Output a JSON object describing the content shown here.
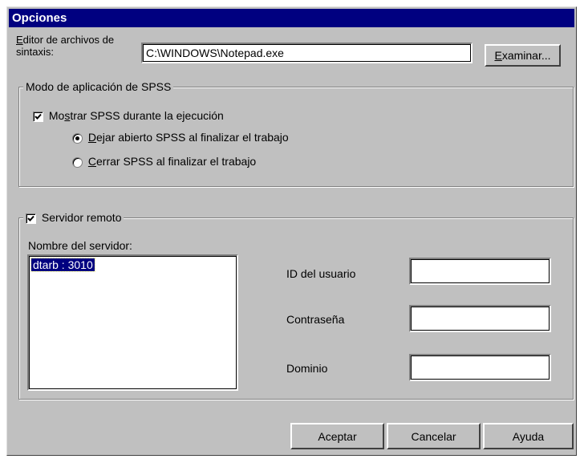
{
  "dialog": {
    "title": "Opciones"
  },
  "syntax_editor": {
    "label_line1_access": "E",
    "label_line1_rest": "ditor de archivos de",
    "label_line2": "sintaxis:",
    "value": "C:\\WINDOWS\\Notepad.exe",
    "browse_access": "E",
    "browse_rest": "xaminar..."
  },
  "spss_mode": {
    "legend": "Modo de aplicación de SPSS",
    "show_checkbox": {
      "label_pre": "Mo",
      "label_access": "s",
      "label_post": "trar SPSS durante la ejecución",
      "checked": true
    },
    "options": [
      {
        "access": "D",
        "rest": "ejar abierto SPSS al finalizar el trabajo",
        "selected": true
      },
      {
        "access": "C",
        "rest": "errar SPSS al finalizar el trabajo",
        "selected": false
      }
    ]
  },
  "remote_server": {
    "legend": "Servidor remoto",
    "checked": true,
    "server_name_label": "Nombre del servidor:",
    "servers": [
      "dtarb : 3010"
    ],
    "user_id_label": "ID del usuario",
    "user_id_value": "",
    "password_label": "Contraseña",
    "password_value": "",
    "domain_label": "Dominio",
    "domain_value": ""
  },
  "buttons": {
    "ok": "Aceptar",
    "cancel": "Cancelar",
    "help": "Ayuda"
  }
}
